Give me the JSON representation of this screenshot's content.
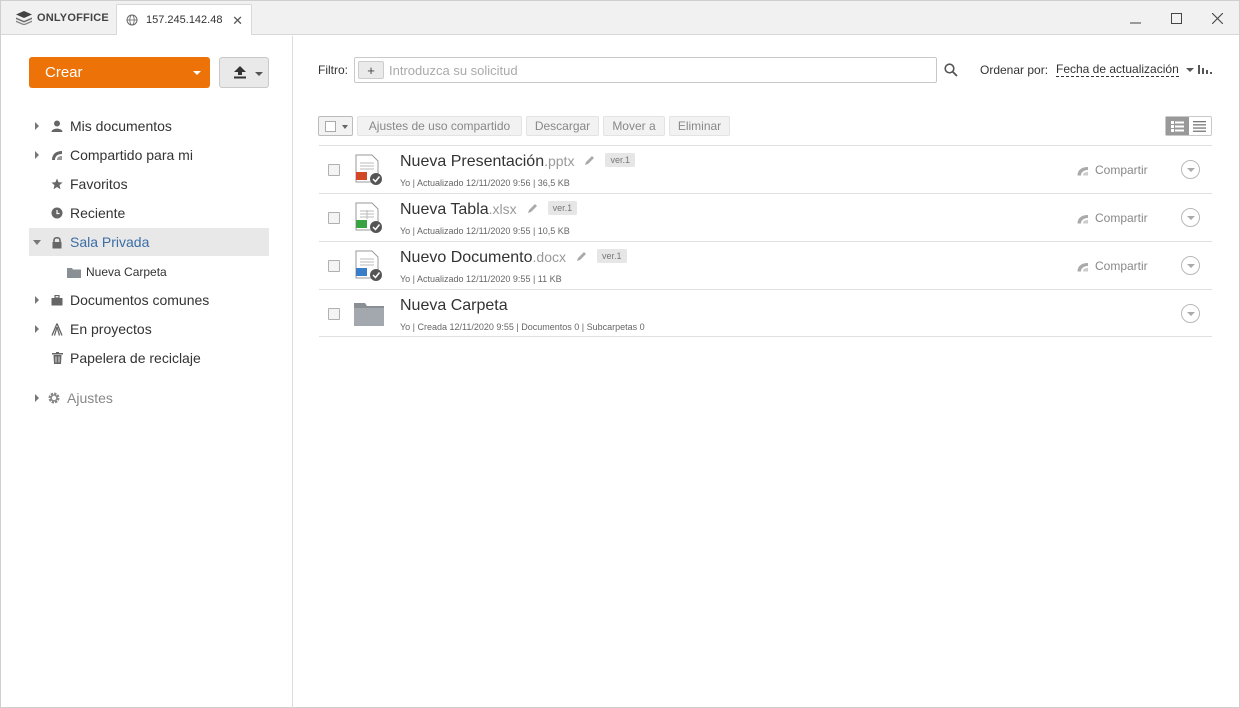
{
  "titlebar": {
    "brand": "ONLYOFFICE",
    "tab_title": "157.245.142.48",
    "tab_close": "✕",
    "minimize": "—",
    "maximize": "☐",
    "close": "✕"
  },
  "sidebar": {
    "create_label": "Crear",
    "items": [
      {
        "label": "Mis documentos",
        "icon": "user-icon"
      },
      {
        "label": "Compartido para mi",
        "icon": "share-icon"
      },
      {
        "label": "Favoritos",
        "icon": "star-icon"
      },
      {
        "label": "Reciente",
        "icon": "clock-icon"
      },
      {
        "label": "Sala Privada",
        "icon": "lock-icon"
      },
      {
        "label": "Documentos comunes",
        "icon": "briefcase-icon"
      },
      {
        "label": "En proyectos",
        "icon": "projects-icon"
      },
      {
        "label": "Papelera de reciclaje",
        "icon": "trash-icon"
      }
    ],
    "sub_item": "Nueva Carpeta",
    "settings_label": "Ajustes"
  },
  "filter": {
    "label": "Filtro:",
    "plus": "+",
    "placeholder": "Introduzca su solicitud"
  },
  "sort": {
    "label": "Ordenar por:",
    "value": "Fecha de actualización"
  },
  "toolbar": {
    "share_settings": "Ajustes de uso compartido",
    "download": "Descargar",
    "move_to": "Mover a",
    "delete": "Eliminar"
  },
  "files": [
    {
      "name": "Nueva Presentación",
      "ext": ".pptx",
      "version": "ver.1",
      "meta": "Yo | Actualizado 12/11/2020 9:56 | 36,5 KB",
      "share": "Compartir",
      "type": "pptx",
      "accent": "#d24726"
    },
    {
      "name": "Nueva Tabla",
      "ext": ".xlsx",
      "version": "ver.1",
      "meta": "Yo | Actualizado 12/11/2020 9:55 | 10,5 KB",
      "share": "Compartir",
      "type": "xlsx",
      "accent": "#3aa341"
    },
    {
      "name": "Nuevo Documento",
      "ext": ".docx",
      "version": "ver.1",
      "meta": "Yo | Actualizado 12/11/2020 9:55 | 11 KB",
      "share": "Compartir",
      "type": "docx",
      "accent": "#3a7dc9"
    },
    {
      "name": "Nueva Carpeta",
      "meta": "Yo | Creada 12/11/2020 9:55 | Documentos  0 | Subcarpetas 0",
      "type": "folder"
    }
  ]
}
